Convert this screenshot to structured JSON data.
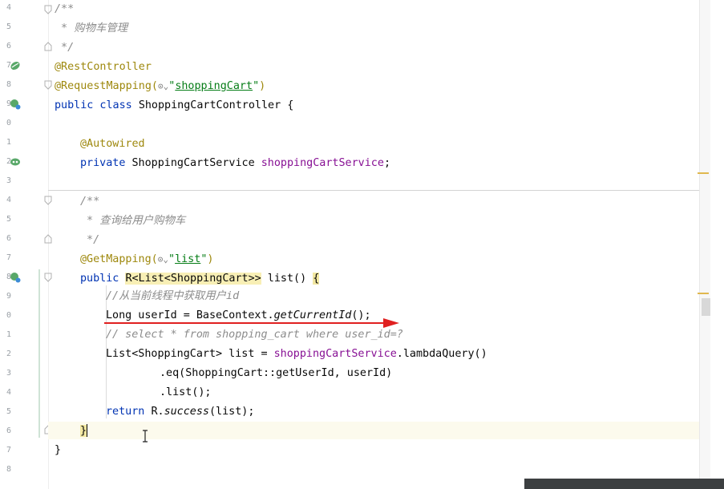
{
  "line_numbers": [
    "4",
    "5",
    "6",
    "7",
    "8",
    "9",
    "0",
    "1",
    "2",
    "3",
    "4",
    "5",
    "6",
    "7",
    "8",
    "9",
    "0",
    "1",
    "2",
    "3",
    "4",
    "5",
    "6",
    "7",
    "8"
  ],
  "code": {
    "l1": "/**",
    "l2": " * 购物车管理",
    "l3": " */",
    "l4": "@RestController",
    "l5_ann": "@RequestMapping(",
    "l5_icon": "⊙⌄",
    "l5_str": "\"shoppingCart\"",
    "l5_end": ")",
    "l6_kw": "public class ",
    "l6_rest": "ShoppingCartController {",
    "l8": "@Autowired",
    "l9_kw": "private ",
    "l9_type": "ShoppingCartService ",
    "l9_field": "shoppingCartService",
    "l9_end": ";",
    "l11": "/**",
    "l12": " * 查询给用户购物车",
    "l13": " */",
    "l14_ann": "@GetMapping(",
    "l14_icon": "⊙⌄",
    "l14_str": "\"list\"",
    "l14_end": ")",
    "l15_kw": "public ",
    "l15_type": "R<List<ShoppingCart>>",
    "l15_rest": " list() ",
    "l15_brace": "{",
    "l16": "//从当前线程中获取用户id",
    "l17_a": "Long userId = BaseContext.",
    "l17_b": "getCurrentId",
    "l17_c": "();",
    "l18": "// select * from shopping_cart where user_id=?",
    "l19_a": "List<ShoppingCart> list = ",
    "l19_b": "shoppingCartService",
    "l19_c": ".lambdaQuery()",
    "l20": ".eq(ShoppingCart::getUserId, userId)",
    "l21": ".list();",
    "l22_kw": "return ",
    "l22_a": "R.",
    "l22_b": "success",
    "l22_c": "(list);",
    "l23": "}",
    "l24": "}"
  },
  "colors": {
    "keyword": "#0033b3",
    "annotation": "#9e880d",
    "string": "#067d17",
    "field": "#871094",
    "comment": "#8c8c8c",
    "arrow": "#e02020"
  },
  "icons": [
    "bean-icon",
    "web-endpoint-icon",
    "fold-marker-icon",
    "text-cursor-icon"
  ]
}
